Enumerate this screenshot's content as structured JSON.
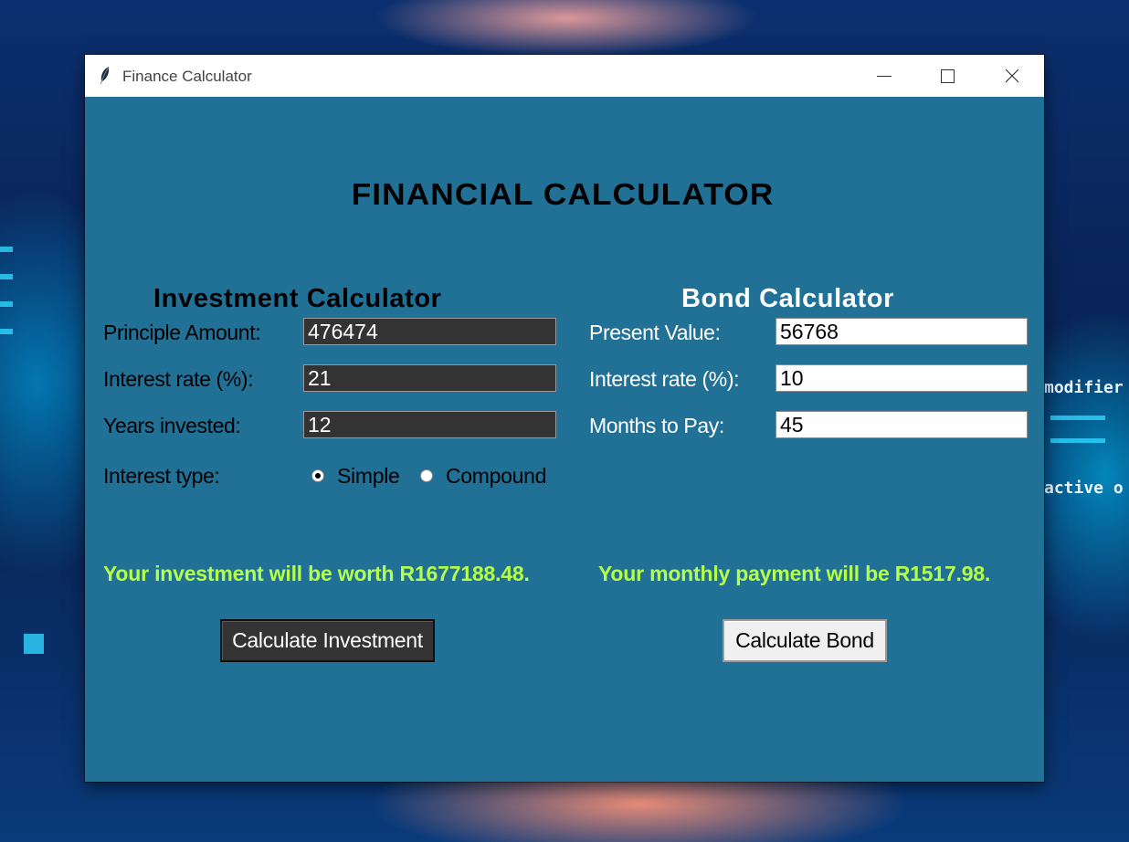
{
  "window": {
    "title": "Finance Calculator"
  },
  "app": {
    "heading": "FINANCIAL CALCULATOR"
  },
  "investment": {
    "title": "Investment Calculator",
    "principal_label": "Principle Amount:",
    "principal_value": "476474",
    "rate_label": "Interest rate (%):",
    "rate_value": "21",
    "years_label": "Years invested:",
    "years_value": "12",
    "type_label": "Interest type:",
    "options": [
      "Simple",
      "Compound"
    ],
    "selected_option": "Simple",
    "result": "Your investment will be worth R1677188.48.",
    "button_label": "Calculate Investment"
  },
  "bond": {
    "title": "Bond Calculator",
    "present_value_label": "Present Value:",
    "present_value": "56768",
    "rate_label": "Interest rate (%):",
    "rate_value": "10",
    "months_label": "Months to Pay:",
    "months_value": "45",
    "result": "Your monthly payment will be R1517.98.",
    "button_label": "Calculate Bond"
  },
  "wallpaper": {
    "text_1": "modifier",
    "text_2": "active o"
  },
  "colors": {
    "window_background": "#217196",
    "result_text": "#b6ff4a",
    "dark_field": "#333333"
  }
}
